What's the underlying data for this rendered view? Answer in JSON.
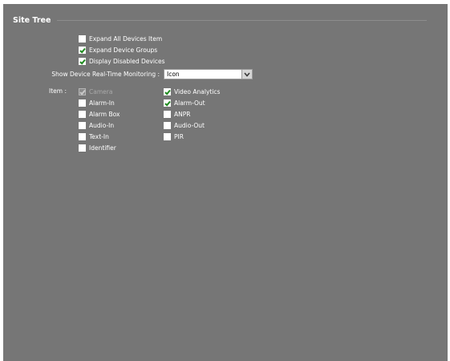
{
  "section": {
    "title": "Site Tree"
  },
  "options": [
    {
      "label": "Expand All Devices Item",
      "checked": false
    },
    {
      "label": "Expand Device Groups",
      "checked": true
    },
    {
      "label": "Display Disabled Devices",
      "checked": true
    }
  ],
  "monitoring": {
    "label": "Show Device Real-Time Monitoring :",
    "value": "Icon"
  },
  "items": {
    "label": "Item :",
    "left": [
      {
        "label": "Camera",
        "checked": true,
        "disabled": true
      },
      {
        "label": "Alarm-In",
        "checked": false
      },
      {
        "label": "Alarm Box",
        "checked": false
      },
      {
        "label": "Audio-In",
        "checked": false
      },
      {
        "label": "Text-In",
        "checked": false
      },
      {
        "label": "Identifier",
        "checked": false
      }
    ],
    "right": [
      {
        "label": "Video Analytics",
        "checked": true
      },
      {
        "label": "Alarm-Out",
        "checked": true
      },
      {
        "label": "ANPR",
        "checked": false
      },
      {
        "label": "Audio-Out",
        "checked": false
      },
      {
        "label": "PIR",
        "checked": false
      }
    ]
  },
  "colors": {
    "panel": "#767676",
    "check": "#1f8a1f"
  }
}
